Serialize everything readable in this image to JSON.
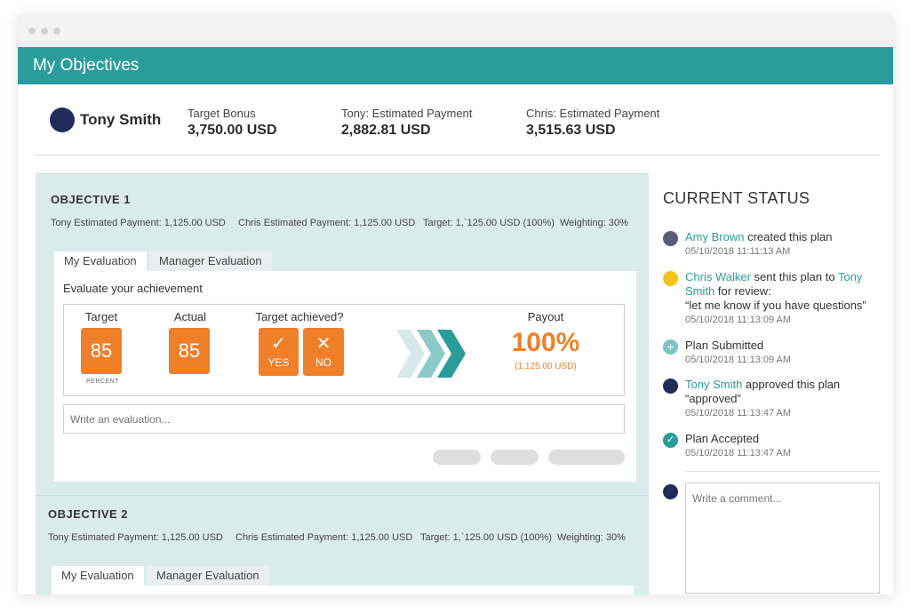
{
  "app": {
    "title": "My Objectives"
  },
  "user": {
    "name": "Tony Smith",
    "avatar_color": "#1f2c5c"
  },
  "summary": [
    {
      "label": "Target Bonus",
      "value": "3,750.00 USD"
    },
    {
      "label": "Tony: Estimated Payment",
      "value": "2,882.81 USD"
    },
    {
      "label": "Chris: Estimated Payment",
      "value": "3,515.63 USD"
    }
  ],
  "objectives": [
    {
      "title": "OBJECTIVE 1",
      "meta": [
        "Tony Estimated Payment: 1,125.00 USD",
        "Chris Estimated Payment: 1,125.00 USD",
        "Target: 1,`125.00 USD (100%)",
        "Weighting: 30%"
      ],
      "tabs": [
        "My Evaluation",
        "Manager Evaluation"
      ],
      "eval_heading": "Evaluate your achievement",
      "target_label": "Target",
      "target_value": "85",
      "target_unit": "PERCENT",
      "actual_label": "Actual",
      "actual_value": "85",
      "achieved_label": "Target achieved?",
      "yes_label": "YES",
      "no_label": "NO",
      "payout_label": "Payout",
      "payout_value": "100%",
      "payout_amount": "(1,125.00 USD)",
      "eval_placeholder": "Write an evaluation..."
    },
    {
      "title": "OBJECTIVE 2",
      "meta": [
        "Tony Estimated Payment: 1,125.00 USD",
        "Chris Estimated Payment: 1,125.00 USD",
        "Target: 1,`125.00 USD (100%)",
        "Weighting: 30%"
      ],
      "tabs": [
        "My Evaluation",
        "Manager Evaluation"
      ]
    }
  ],
  "status": {
    "heading": "CURRENT STATUS",
    "events": [
      {
        "actor": "Amy Brown",
        "text": " created this plan",
        "time": "05/10/2018  11:11:13 AM",
        "dot": "#5b5b7a"
      },
      {
        "actor": "Chris Walker",
        "text": " sent this plan to ",
        "target": "Tony Smith",
        "text2": " for review:",
        "quote": "“let me know if you have questions”",
        "time": "05/10/2018  11:13:09 AM",
        "dot": "#f2c31a"
      },
      {
        "text": "Plan Submitted",
        "time": "05/10/2018  11:13:09 AM",
        "dot": "#7cc6c4"
      },
      {
        "actor": "Tony Smith",
        "text": " approved this plan",
        "quote": "“approved”",
        "time": "05/10/2018  11:13:47 AM",
        "dot": "#1f2c5c"
      },
      {
        "text": "Plan Accepted",
        "time": "05/10/2018  11:13:47 AM",
        "dot": "#2a9d9b"
      }
    ],
    "comment_placeholder": "Write a comment..."
  },
  "colors": {
    "accent": "#2a9d9b",
    "orange": "#f07f2a",
    "panel": "#d9ecea"
  },
  "icons": {
    "check": "check-icon",
    "cross": "close-icon",
    "plus": "plus-icon",
    "chevrons": "chevron-right-icon"
  }
}
